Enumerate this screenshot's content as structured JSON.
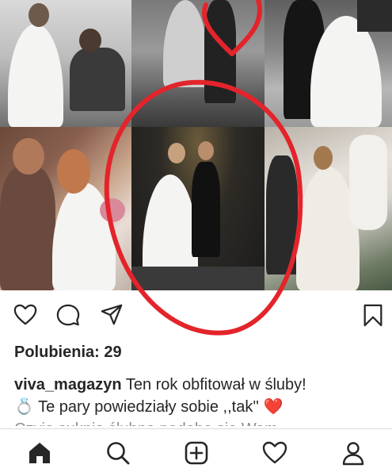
{
  "post": {
    "likes_label": "Polubienia: 29",
    "username": "viva_magazyn",
    "caption_line1": " Ten rok obfitował w śluby!",
    "caption_emoji_ring": "💍",
    "caption_line2": " Te pary powiedziały sobie ,,tak'' ",
    "caption_emoji_heart": "❤️",
    "caption_line3": "Czyja suknia ślubna podoba się Wam"
  },
  "icons": {
    "actions": [
      "heart-icon",
      "comment-icon",
      "share-icon",
      "bookmark-icon"
    ],
    "tabs": [
      "home-icon",
      "search-icon",
      "add-icon",
      "activity-heart-icon",
      "profile-icon"
    ]
  },
  "colors": {
    "annotation": "#e3242b",
    "text": "#262626",
    "muted": "#8e8e8e",
    "divider": "#dbdbdb"
  }
}
